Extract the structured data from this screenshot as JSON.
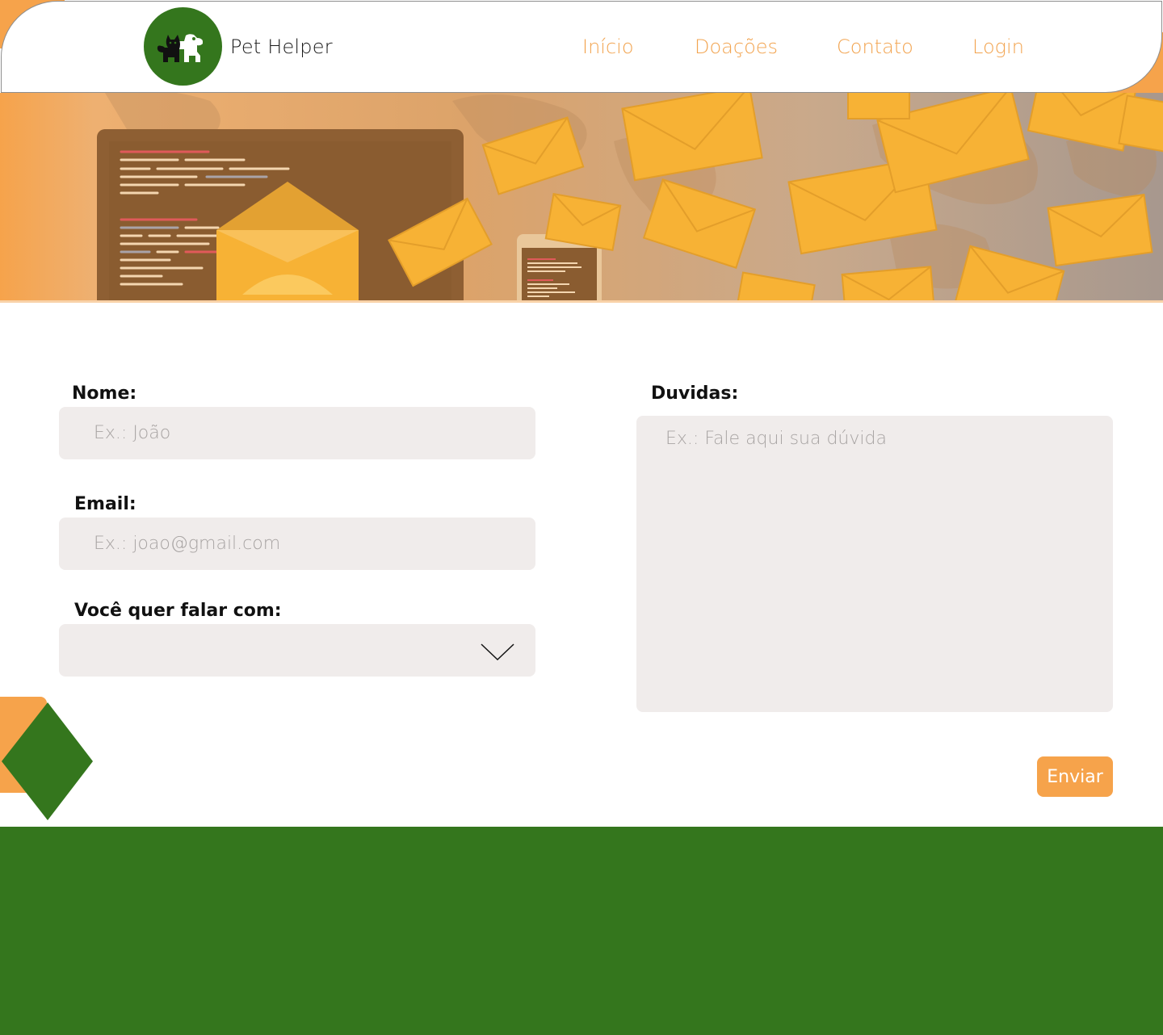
{
  "brand": {
    "name": "Pet Helper",
    "logo_icon": "cat-dog-icon"
  },
  "nav": {
    "items": [
      {
        "label": "Início"
      },
      {
        "label": "Doações"
      },
      {
        "label": "Contato"
      },
      {
        "label": "Login"
      }
    ]
  },
  "form": {
    "name": {
      "label": "Nome:",
      "placeholder": "Ex.: João",
      "value": ""
    },
    "email": {
      "label": "Email:",
      "placeholder": "Ex.: joao@gmail.com",
      "value": ""
    },
    "contact_with": {
      "label": "Você quer falar com:",
      "selected": ""
    },
    "questions": {
      "label": "Duvidas:",
      "placeholder": "Ex.: Fale aqui sua dúvida",
      "value": ""
    },
    "submit_label": "Enviar"
  },
  "colors": {
    "primary_green": "#34761d",
    "accent_orange": "#f6a34b",
    "field_bg": "#f0eceb"
  }
}
